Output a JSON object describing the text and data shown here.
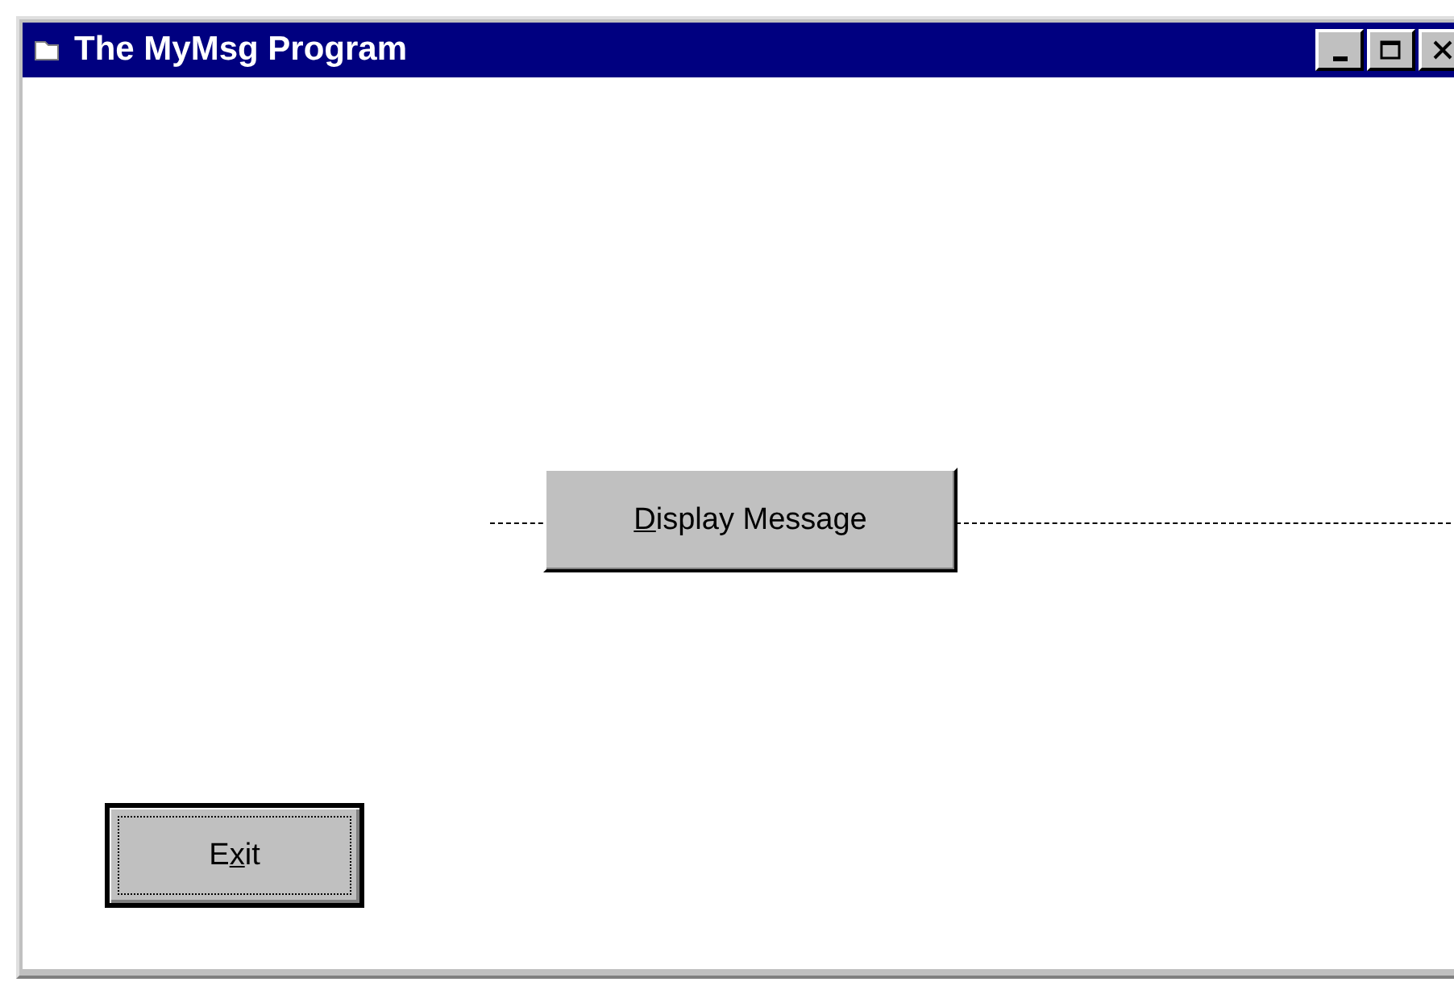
{
  "window": {
    "title": "The MyMsg Program"
  },
  "buttons": [
    {
      "parts": [
        {
          "text": "D",
          "underlined": true
        },
        {
          "text": "isplay Message",
          "underlined": false
        }
      ],
      "focused": false
    },
    {
      "parts": [
        {
          "text": "E",
          "underlined": false
        },
        {
          "text": "x",
          "underlined": true
        },
        {
          "text": "it",
          "underlined": false
        }
      ],
      "focused": true
    }
  ]
}
